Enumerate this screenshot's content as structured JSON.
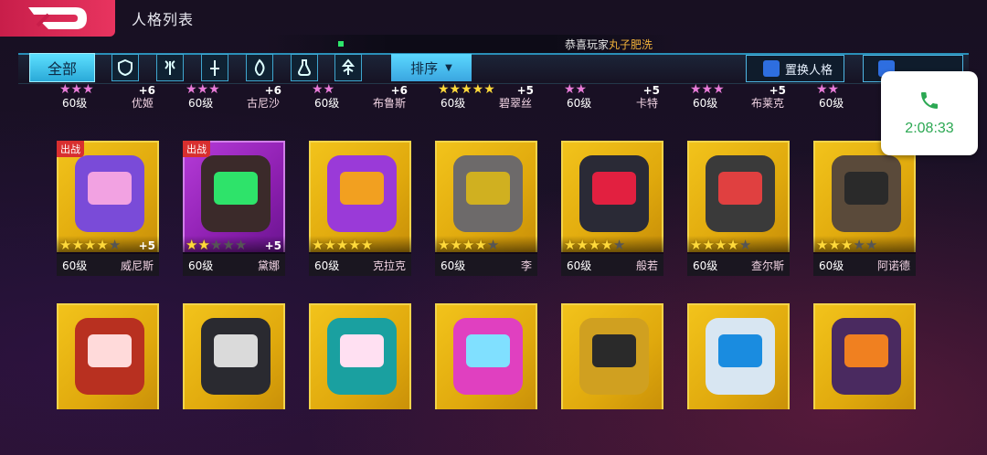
{
  "header": {
    "title": "人格列表",
    "ticker_prefix": "恭喜玩家",
    "ticker_player": "丸子肥洗"
  },
  "filters": {
    "all_label": "全部",
    "role_icons": [
      "shield-role-icon",
      "axe-role-icon",
      "sword-role-icon",
      "flame-role-icon",
      "potion-role-icon",
      "arrow-role-icon"
    ],
    "sort_label": "排序",
    "swap_label": "置换人格"
  },
  "top_row": [
    {
      "level": "60级",
      "name": "优姬",
      "stars": "pink",
      "plus": "+6"
    },
    {
      "level": "60级",
      "name": "古尼沙",
      "stars": "pink",
      "plus": "+6"
    },
    {
      "level": "60级",
      "name": "布鲁斯",
      "stars": "pink",
      "plus": "+6"
    },
    {
      "level": "60级",
      "name": "碧翠丝",
      "stars": "yellow",
      "plus": "+5"
    },
    {
      "level": "60级",
      "name": "卡特",
      "stars": "pink",
      "plus": "+5"
    },
    {
      "level": "60级",
      "name": "布莱克",
      "stars": "pink",
      "plus": "+5"
    },
    {
      "level": "60级",
      "name": "",
      "stars": "pink",
      "plus": ""
    }
  ],
  "mid_row": [
    {
      "level": "60级",
      "name": "威尼斯",
      "stars": 4,
      "plus": "+5",
      "deployed": "出战",
      "theme": "gold",
      "art": "#7a4bd8",
      "face": "#f2a2e2"
    },
    {
      "level": "60级",
      "name": "黛娜",
      "stars": 2,
      "plus": "+5",
      "deployed": "出战",
      "theme": "purple",
      "art": "#3b2a2a",
      "face": "#2ee36a"
    },
    {
      "level": "60级",
      "name": "克拉克",
      "stars": 5,
      "plus": "",
      "deployed": "",
      "theme": "gold",
      "art": "#9a3ad8",
      "face": "#f2a020"
    },
    {
      "level": "60级",
      "name": "李",
      "stars": 4,
      "plus": "",
      "deployed": "",
      "theme": "gold",
      "art": "#6d6a6a",
      "face": "#d0b020"
    },
    {
      "level": "60级",
      "name": "般若",
      "stars": 4,
      "plus": "",
      "deployed": "",
      "theme": "gold",
      "art": "#2a2a36",
      "face": "#e22040"
    },
    {
      "level": "60级",
      "name": "查尔斯",
      "stars": 4,
      "plus": "",
      "deployed": "",
      "theme": "gold",
      "art": "#3a3a3a",
      "face": "#e04040"
    },
    {
      "level": "60级",
      "name": "阿诺德",
      "stars": 3,
      "plus": "",
      "deployed": "",
      "theme": "gold",
      "art": "#5a4a3a",
      "face": "#2a2a2a"
    }
  ],
  "bottom_row": [
    {
      "art": "#b83020",
      "face": "#ffdada"
    },
    {
      "art": "#2a2a30",
      "face": "#dadada"
    },
    {
      "art": "#1aa0a0",
      "face": "#ffe0f2"
    },
    {
      "art": "#e040c0",
      "face": "#80e0ff"
    },
    {
      "art": "#d0a020",
      "face": "#2a2a2a"
    },
    {
      "art": "#d8e6f2",
      "face": "#1a8ce0"
    },
    {
      "art": "#4a2a60",
      "face": "#f08020"
    }
  ],
  "call_overlay": {
    "duration": "2:08:33",
    "icon": "phone-icon"
  },
  "colors": {
    "accent_cyan": "#5de0ff",
    "back_red": "#e8345f",
    "gold_card": "#f2c31b",
    "purple_card": "#b53bd8",
    "call_green": "#2ca853"
  }
}
